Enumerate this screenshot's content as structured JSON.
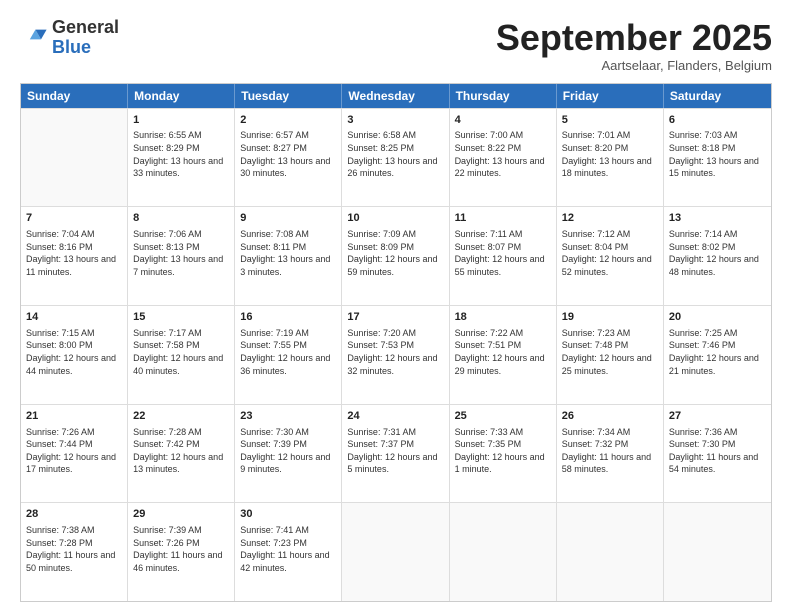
{
  "logo": {
    "text_general": "General",
    "text_blue": "Blue"
  },
  "header": {
    "month": "September 2025",
    "location": "Aartselaar, Flanders, Belgium"
  },
  "weekdays": [
    "Sunday",
    "Monday",
    "Tuesday",
    "Wednesday",
    "Thursday",
    "Friday",
    "Saturday"
  ],
  "rows": [
    [
      {
        "day": "",
        "sunrise": "",
        "sunset": "",
        "daylight": ""
      },
      {
        "day": "1",
        "sunrise": "Sunrise: 6:55 AM",
        "sunset": "Sunset: 8:29 PM",
        "daylight": "Daylight: 13 hours and 33 minutes."
      },
      {
        "day": "2",
        "sunrise": "Sunrise: 6:57 AM",
        "sunset": "Sunset: 8:27 PM",
        "daylight": "Daylight: 13 hours and 30 minutes."
      },
      {
        "day": "3",
        "sunrise": "Sunrise: 6:58 AM",
        "sunset": "Sunset: 8:25 PM",
        "daylight": "Daylight: 13 hours and 26 minutes."
      },
      {
        "day": "4",
        "sunrise": "Sunrise: 7:00 AM",
        "sunset": "Sunset: 8:22 PM",
        "daylight": "Daylight: 13 hours and 22 minutes."
      },
      {
        "day": "5",
        "sunrise": "Sunrise: 7:01 AM",
        "sunset": "Sunset: 8:20 PM",
        "daylight": "Daylight: 13 hours and 18 minutes."
      },
      {
        "day": "6",
        "sunrise": "Sunrise: 7:03 AM",
        "sunset": "Sunset: 8:18 PM",
        "daylight": "Daylight: 13 hours and 15 minutes."
      }
    ],
    [
      {
        "day": "7",
        "sunrise": "Sunrise: 7:04 AM",
        "sunset": "Sunset: 8:16 PM",
        "daylight": "Daylight: 13 hours and 11 minutes."
      },
      {
        "day": "8",
        "sunrise": "Sunrise: 7:06 AM",
        "sunset": "Sunset: 8:13 PM",
        "daylight": "Daylight: 13 hours and 7 minutes."
      },
      {
        "day": "9",
        "sunrise": "Sunrise: 7:08 AM",
        "sunset": "Sunset: 8:11 PM",
        "daylight": "Daylight: 13 hours and 3 minutes."
      },
      {
        "day": "10",
        "sunrise": "Sunrise: 7:09 AM",
        "sunset": "Sunset: 8:09 PM",
        "daylight": "Daylight: 12 hours and 59 minutes."
      },
      {
        "day": "11",
        "sunrise": "Sunrise: 7:11 AM",
        "sunset": "Sunset: 8:07 PM",
        "daylight": "Daylight: 12 hours and 55 minutes."
      },
      {
        "day": "12",
        "sunrise": "Sunrise: 7:12 AM",
        "sunset": "Sunset: 8:04 PM",
        "daylight": "Daylight: 12 hours and 52 minutes."
      },
      {
        "day": "13",
        "sunrise": "Sunrise: 7:14 AM",
        "sunset": "Sunset: 8:02 PM",
        "daylight": "Daylight: 12 hours and 48 minutes."
      }
    ],
    [
      {
        "day": "14",
        "sunrise": "Sunrise: 7:15 AM",
        "sunset": "Sunset: 8:00 PM",
        "daylight": "Daylight: 12 hours and 44 minutes."
      },
      {
        "day": "15",
        "sunrise": "Sunrise: 7:17 AM",
        "sunset": "Sunset: 7:58 PM",
        "daylight": "Daylight: 12 hours and 40 minutes."
      },
      {
        "day": "16",
        "sunrise": "Sunrise: 7:19 AM",
        "sunset": "Sunset: 7:55 PM",
        "daylight": "Daylight: 12 hours and 36 minutes."
      },
      {
        "day": "17",
        "sunrise": "Sunrise: 7:20 AM",
        "sunset": "Sunset: 7:53 PM",
        "daylight": "Daylight: 12 hours and 32 minutes."
      },
      {
        "day": "18",
        "sunrise": "Sunrise: 7:22 AM",
        "sunset": "Sunset: 7:51 PM",
        "daylight": "Daylight: 12 hours and 29 minutes."
      },
      {
        "day": "19",
        "sunrise": "Sunrise: 7:23 AM",
        "sunset": "Sunset: 7:48 PM",
        "daylight": "Daylight: 12 hours and 25 minutes."
      },
      {
        "day": "20",
        "sunrise": "Sunrise: 7:25 AM",
        "sunset": "Sunset: 7:46 PM",
        "daylight": "Daylight: 12 hours and 21 minutes."
      }
    ],
    [
      {
        "day": "21",
        "sunrise": "Sunrise: 7:26 AM",
        "sunset": "Sunset: 7:44 PM",
        "daylight": "Daylight: 12 hours and 17 minutes."
      },
      {
        "day": "22",
        "sunrise": "Sunrise: 7:28 AM",
        "sunset": "Sunset: 7:42 PM",
        "daylight": "Daylight: 12 hours and 13 minutes."
      },
      {
        "day": "23",
        "sunrise": "Sunrise: 7:30 AM",
        "sunset": "Sunset: 7:39 PM",
        "daylight": "Daylight: 12 hours and 9 minutes."
      },
      {
        "day": "24",
        "sunrise": "Sunrise: 7:31 AM",
        "sunset": "Sunset: 7:37 PM",
        "daylight": "Daylight: 12 hours and 5 minutes."
      },
      {
        "day": "25",
        "sunrise": "Sunrise: 7:33 AM",
        "sunset": "Sunset: 7:35 PM",
        "daylight": "Daylight: 12 hours and 1 minute."
      },
      {
        "day": "26",
        "sunrise": "Sunrise: 7:34 AM",
        "sunset": "Sunset: 7:32 PM",
        "daylight": "Daylight: 11 hours and 58 minutes."
      },
      {
        "day": "27",
        "sunrise": "Sunrise: 7:36 AM",
        "sunset": "Sunset: 7:30 PM",
        "daylight": "Daylight: 11 hours and 54 minutes."
      }
    ],
    [
      {
        "day": "28",
        "sunrise": "Sunrise: 7:38 AM",
        "sunset": "Sunset: 7:28 PM",
        "daylight": "Daylight: 11 hours and 50 minutes."
      },
      {
        "day": "29",
        "sunrise": "Sunrise: 7:39 AM",
        "sunset": "Sunset: 7:26 PM",
        "daylight": "Daylight: 11 hours and 46 minutes."
      },
      {
        "day": "30",
        "sunrise": "Sunrise: 7:41 AM",
        "sunset": "Sunset: 7:23 PM",
        "daylight": "Daylight: 11 hours and 42 minutes."
      },
      {
        "day": "",
        "sunrise": "",
        "sunset": "",
        "daylight": ""
      },
      {
        "day": "",
        "sunrise": "",
        "sunset": "",
        "daylight": ""
      },
      {
        "day": "",
        "sunrise": "",
        "sunset": "",
        "daylight": ""
      },
      {
        "day": "",
        "sunrise": "",
        "sunset": "",
        "daylight": ""
      }
    ]
  ]
}
